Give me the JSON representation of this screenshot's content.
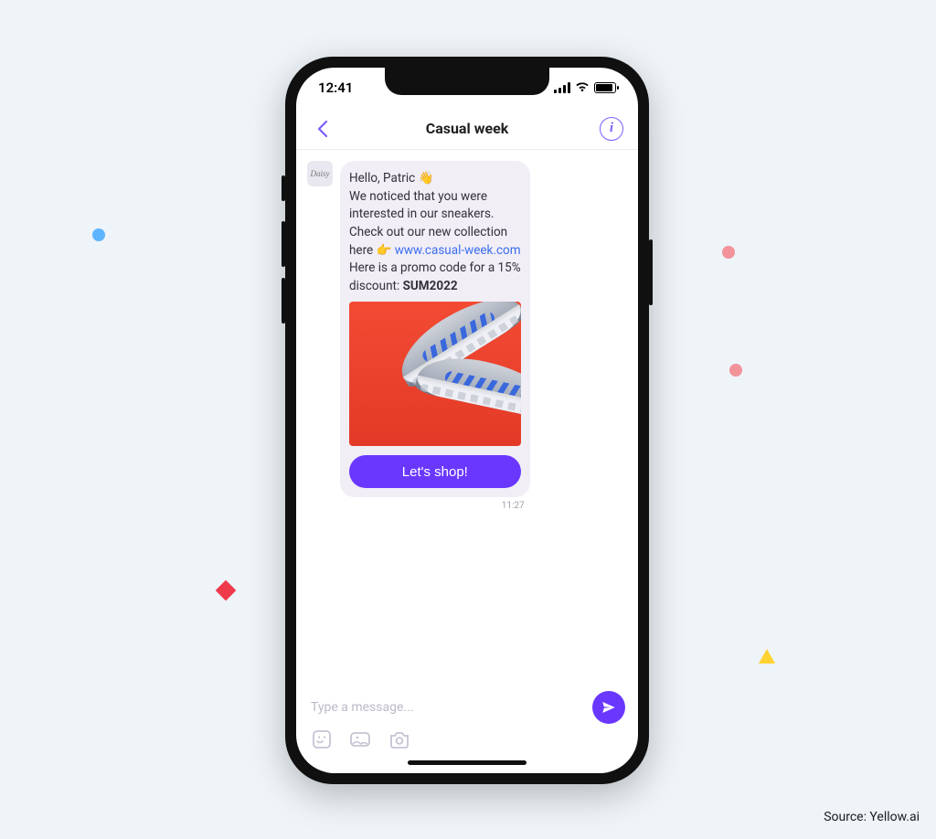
{
  "source_label": "Source: Yellow.ai",
  "statusbar": {
    "time": "12:41"
  },
  "header": {
    "title": "Casual week"
  },
  "avatar_text": "Daisy",
  "message": {
    "greeting_prefix": "Hello, Patric ",
    "greeting_emoji": "👋",
    "body_line1": "We noticed that you were",
    "body_line2": "interested in our sneakers.",
    "body_line3": "Check out our new collection",
    "here_prefix": "here ",
    "pointer_emoji": "👉",
    "link_text": "www.casual-week.com",
    "promo_line1": "Here is a promo code for a 15%",
    "promo_prefix": "discount: ",
    "promo_code": "SUM2022",
    "cta_label": "Let's shop!",
    "timestamp": "11:27"
  },
  "composer": {
    "placeholder": "Type a message..."
  }
}
